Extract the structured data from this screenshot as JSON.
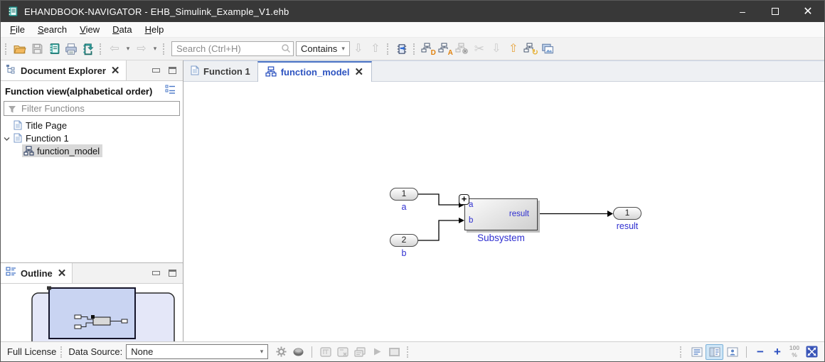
{
  "window": {
    "title": "EHANDBOOK-NAVIGATOR - EHB_Simulink_Example_V1.ehb",
    "minimize_glyph": "–",
    "close_glyph": "✕"
  },
  "menu": {
    "items": [
      {
        "accel": "F",
        "rest": "ile"
      },
      {
        "accel": "S",
        "rest": "earch"
      },
      {
        "accel": "V",
        "rest": "iew"
      },
      {
        "accel": "D",
        "rest": "ata"
      },
      {
        "accel": "H",
        "rest": "elp"
      }
    ]
  },
  "toolbar": {
    "search_placeholder": "Search (Ctrl+H)",
    "contains_label": "Contains",
    "glyphs": {
      "back": "⇦",
      "forward": "⇨",
      "caret": "▾",
      "down": "⇩",
      "up": "⇧",
      "cut": "✂",
      "tree_d": "D",
      "tree_a": "A",
      "tree_x": "×",
      "tree_reload": "↻"
    },
    "icon_names": [
      "open-folder-icon",
      "save-icon",
      "open-handbook-icon",
      "print-icon",
      "close-handbook-icon",
      "back-icon",
      "forward-icon",
      "search-icon",
      "contains-dropdown",
      "scope-down-icon",
      "scope-up-icon",
      "model-chip-icon",
      "tree-display-icon",
      "tree-annotation-icon",
      "tree-remove-icon",
      "cut-icon",
      "arrow-down-icon",
      "arrow-up-icon",
      "tree-reload-icon",
      "images-icon"
    ]
  },
  "explorer": {
    "tab_label": "Document Explorer",
    "close_glyph": "✕",
    "view_title": "Function view(alphabetical order)",
    "filter_placeholder": "Filter Functions",
    "tree": [
      {
        "label": "Title Page"
      },
      {
        "label": "Function 1"
      },
      {
        "label": "function_model"
      }
    ]
  },
  "outline": {
    "tab_label": "Outline",
    "close_glyph": "✕"
  },
  "editor": {
    "tabs": [
      {
        "label": "Function 1"
      },
      {
        "label": "function_model",
        "close_glyph": "✕"
      }
    ]
  },
  "diagram": {
    "inport1_number": "1",
    "inport1_label": "a",
    "inport2_number": "2",
    "inport2_label": "b",
    "subsystem_name": "Subsystem",
    "subsystem_in_a": "a",
    "subsystem_in_b": "b",
    "subsystem_out": "result",
    "expand_badge": "+",
    "outport_number": "1",
    "outport_label": "result"
  },
  "statusbar": {
    "license": "Full License",
    "data_source_label": "Data Source:",
    "data_source_value": "None",
    "caret": "▾",
    "minus": "−",
    "plus": "+",
    "zoom_top": "100",
    "zoom_bottom": "%",
    "icon_names": [
      "gear-icon",
      "database-icon",
      "measure-icon",
      "measure-remove-icon",
      "measure-layers-icon",
      "play-icon",
      "screen-icon",
      "text-view-icon",
      "split-view-icon",
      "person-view-icon",
      "zoom-out-icon",
      "zoom-in-icon",
      "zoom-100-icon",
      "fit-screen-icon"
    ]
  },
  "colors": {
    "titlebar": "#383838",
    "accent_blue": "#2d53c0",
    "diagram_label_blue": "#2f2fd0",
    "teal": "#2e9b9b",
    "selection_gray": "#d9d9d9"
  }
}
